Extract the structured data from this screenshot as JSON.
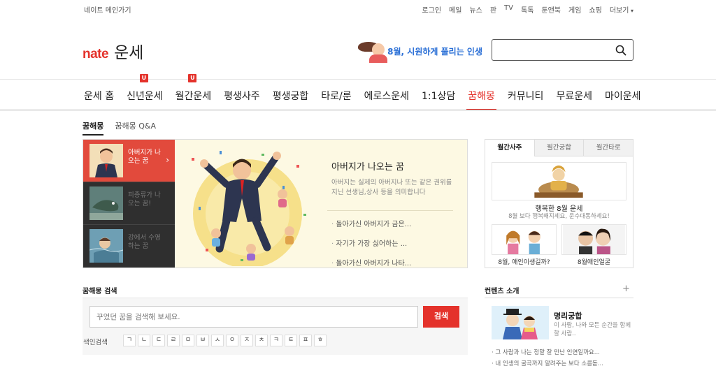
{
  "topbar": {
    "home": "네이트 메인가기",
    "links": [
      "로그인",
      "메일",
      "뉴스",
      "판",
      "TV",
      "톡톡",
      "툰앤북",
      "게임",
      "쇼핑",
      "더보기"
    ]
  },
  "logo": {
    "brand": "nate",
    "service": "운세"
  },
  "banner": {
    "text": "8월, 시원하게 풀리는 인생"
  },
  "search": {
    "placeholder": ""
  },
  "gnb": {
    "items": [
      "운세 홈",
      "신년운세",
      "월간운세",
      "평생사주",
      "평생궁합",
      "타로/룬",
      "에로스운세",
      "1:1상담",
      "꿈해몽",
      "커뮤니티",
      "무료운세",
      "마이운세"
    ],
    "badge": "U"
  },
  "subtabs": [
    "꿈해몽",
    "꿈해몽 Q&A"
  ],
  "feature": {
    "thumbs": [
      "아버지가 나오는 꿈",
      "피층류가 나오는 꿈!",
      "강에서 수영하는 꿈"
    ],
    "title": "아버지가 나오는 꿈",
    "desc": "아버지는 실제의 아버지나 또는 같은 권위를 지닌 선생님,상사 등을 의미합니다",
    "links": [
      "돌아가신 아버지가 금은...",
      "자기가 가장 싫어하는 ...",
      "돌아가신 아버지가 나타..."
    ]
  },
  "right_panel": {
    "tabs": [
      "월간사주",
      "월간궁합",
      "월간타로"
    ],
    "title": "행복한 8월 운세",
    "sub": "8월 보다 행복해지세요, 운수대통하세요!",
    "thumbs": [
      "8월, 애인이생길까?",
      "8월애인얼굴"
    ]
  },
  "dream_search": {
    "title": "꿈해몽 검색",
    "placeholder": "꾸었던 꿈을 검색해 보세요.",
    "button": "검색",
    "index_label": "색인검색",
    "index": [
      "ㄱ",
      "ㄴ",
      "ㄷ",
      "ㄹ",
      "ㅁ",
      "ㅂ",
      "ㅅ",
      "ㅇ",
      "ㅈ",
      "ㅊ",
      "ㅋ",
      "ㅌ",
      "ㅍ",
      "ㅎ"
    ]
  },
  "contents": {
    "title": "컨텐츠 소개",
    "plus": "+",
    "promo_title": "명리궁합",
    "promo_desc": "이 사람, 나와 모든 순간을 함께할 사람..",
    "links": [
      "그 사람과 나는 정말 잘 만난 인연일까요...",
      "내 인생의 굴곡까지 알려주는 보다 소름돋..."
    ]
  },
  "colors": {
    "accent": "#e4322b",
    "banner_text": "#2a6fd6"
  }
}
